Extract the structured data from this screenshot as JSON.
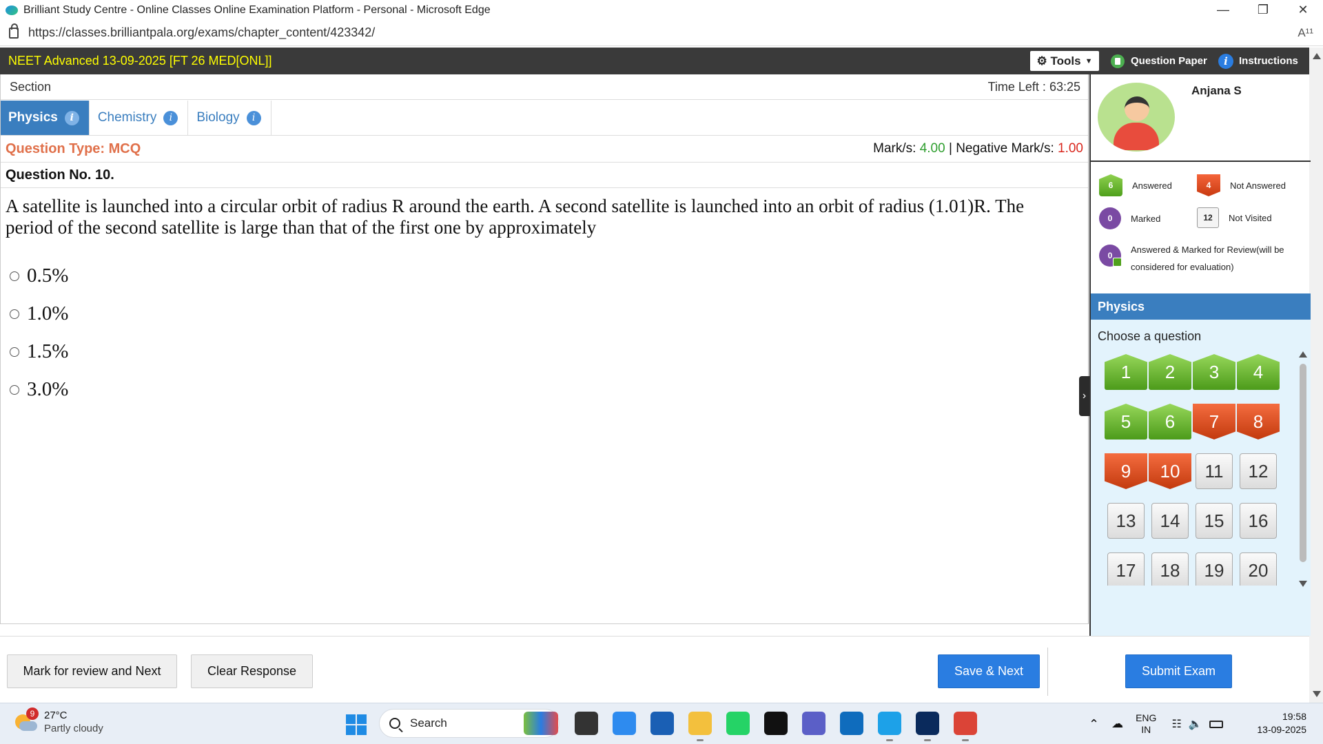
{
  "browser": {
    "title": "Brilliant Study Centre - Online Classes Online Examination Platform - Personal - Microsoft Edge",
    "url": "https://classes.brilliantpala.org/exams/chapter_content/423342/",
    "read_aloud_label": "A¹¹"
  },
  "exam": {
    "title": "NEET Advanced 13-09-2025 [FT 26 MED[ONL]]",
    "tools_label": "⚙ Tools",
    "question_paper_label": "Question Paper",
    "instructions_label": "Instructions"
  },
  "section": {
    "label": "Section",
    "time_left_label": "Time Left :",
    "time_left_value": "63:25",
    "tabs": [
      {
        "label": "Physics",
        "active": true
      },
      {
        "label": "Chemistry",
        "active": false
      },
      {
        "label": "Biology",
        "active": false
      }
    ]
  },
  "question": {
    "type_label": "Question Type: MCQ",
    "marks_label": "Mark/s:",
    "marks_value": "4.00",
    "marks_sep": "|",
    "neg_label": "Negative Mark/s:",
    "neg_value": "1.00",
    "number_label": "Question No. 10.",
    "text": "A satellite is launched into a circular orbit of radius R around the earth. A second satellite is launched into an orbit of radius (1.01)R. The period of the second satellite is large than that of the first one by approximately",
    "options": [
      "0.5%",
      "1.0%",
      "1.5%",
      "3.0%"
    ]
  },
  "profile": {
    "name": "Anjana S"
  },
  "legend": {
    "answered": {
      "count": "6",
      "label": "Answered"
    },
    "not_answered": {
      "count": "4",
      "label": "Not Answered"
    },
    "marked": {
      "count": "0",
      "label": "Marked"
    },
    "not_visited": {
      "count": "12",
      "label": "Not Visited"
    },
    "answered_marked": {
      "count": "0",
      "label": "Answered & Marked for Review(will be considered for evaluation)"
    }
  },
  "palette": {
    "section_title": "Physics",
    "choose_label": "Choose a question",
    "questions": [
      {
        "n": "1",
        "status": "answered"
      },
      {
        "n": "2",
        "status": "answered"
      },
      {
        "n": "3",
        "status": "answered"
      },
      {
        "n": "4",
        "status": "answered"
      },
      {
        "n": "5",
        "status": "answered"
      },
      {
        "n": "6",
        "status": "answered"
      },
      {
        "n": "7",
        "status": "not_answered"
      },
      {
        "n": "8",
        "status": "not_answered"
      },
      {
        "n": "9",
        "status": "not_answered"
      },
      {
        "n": "10",
        "status": "not_answered"
      },
      {
        "n": "11",
        "status": "not_visited"
      },
      {
        "n": "12",
        "status": "not_visited"
      },
      {
        "n": "13",
        "status": "not_visited"
      },
      {
        "n": "14",
        "status": "not_visited"
      },
      {
        "n": "15",
        "status": "not_visited"
      },
      {
        "n": "16",
        "status": "not_visited"
      },
      {
        "n": "17",
        "status": "not_visited"
      },
      {
        "n": "18",
        "status": "not_visited"
      },
      {
        "n": "19",
        "status": "not_visited"
      },
      {
        "n": "20",
        "status": "not_visited"
      },
      {
        "n": "",
        "status": "not_visited"
      },
      {
        "n": "",
        "status": "not_visited"
      }
    ]
  },
  "actions": {
    "mark_review": "Mark for review and Next",
    "clear": "Clear Response",
    "save_next": "Save & Next",
    "submit": "Submit Exam"
  },
  "taskbar": {
    "weather_badge": "9",
    "temperature": "27°C",
    "weather_desc": "Partly cloudy",
    "search_placeholder": "Search",
    "lang_1": "ENG",
    "lang_2": "IN",
    "time": "19:58",
    "date": "13-09-2025",
    "apps": [
      {
        "name": "copilot-icon",
        "color": "#7b61ff"
      },
      {
        "name": "task-view-icon",
        "color": "#333333"
      },
      {
        "name": "microsoft-copilot-icon",
        "color": "#2e8bef"
      },
      {
        "name": "microsoft-store-icon",
        "color": "#1a5fb4"
      },
      {
        "name": "file-explorer-icon",
        "color": "#f3c03d"
      },
      {
        "name": "whatsapp-icon",
        "color": "#25d366"
      },
      {
        "name": "dell-icon",
        "color": "#111111"
      },
      {
        "name": "app-icon",
        "color": "#5b5fc7"
      },
      {
        "name": "outlook-icon",
        "color": "#0f6cbd"
      },
      {
        "name": "edge-icon",
        "color": "#1da1e8"
      },
      {
        "name": "webex-icon",
        "color": "#0a2a5c"
      },
      {
        "name": "chrome-icon",
        "color": "#db4437"
      }
    ]
  }
}
